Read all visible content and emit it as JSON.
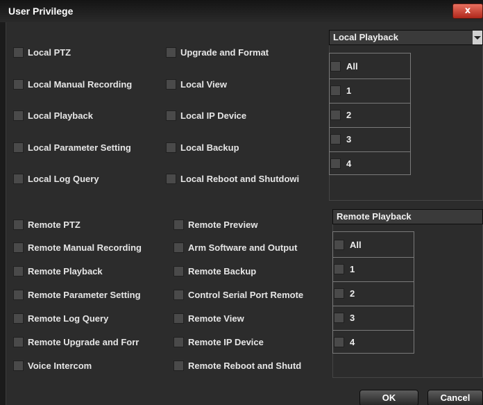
{
  "window": {
    "title": "User Privilege",
    "close_label": "x"
  },
  "local": {
    "col1": [
      "Local PTZ",
      "Local Manual Recording",
      "Local Playback",
      "Local Parameter Setting",
      "Local Log Query"
    ],
    "col2": [
      "Upgrade and Format",
      "Local View",
      "Local IP Device",
      "Local Backup",
      "Local Reboot and Shutdowi"
    ]
  },
  "remote": {
    "col1": [
      "Remote PTZ",
      "Remote Manual Recording",
      "Remote Playback",
      "Remote Parameter Setting",
      "Remote Log Query",
      "Remote Upgrade  and Forr",
      "Voice Intercom"
    ],
    "col2": [
      "Remote Preview",
      "Arm Software and Output",
      "Remote Backup",
      "Control Serial Port Remote",
      "Remote View",
      "Remote IP Device",
      "Remote Reboot and Shutd"
    ]
  },
  "local_playback": {
    "select_value": "Local Playback",
    "channels": [
      "All",
      "1",
      "2",
      "3",
      "4"
    ]
  },
  "remote_playback": {
    "select_value": "Remote Playback",
    "channels": [
      "All",
      "1",
      "2",
      "3",
      "4"
    ]
  },
  "buttons": {
    "ok": "OK",
    "cancel": "Cancel"
  },
  "colors": {
    "background": "#2c2c2c",
    "checkbox": "#4a4a4a",
    "close": "#c9382a"
  }
}
